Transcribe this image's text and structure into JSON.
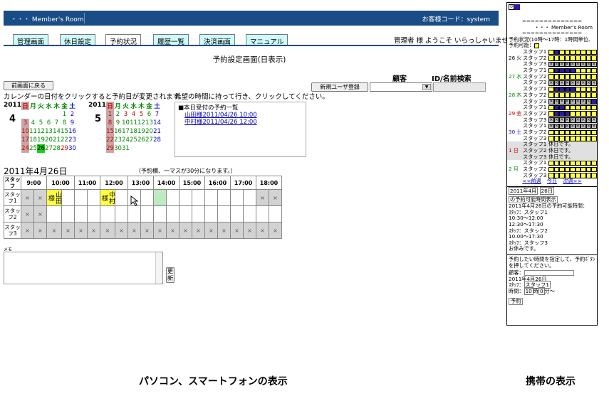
{
  "header": {
    "app_title": "・・・ Member's Room",
    "customer_code": "お客様コード：system"
  },
  "tabs": [
    "管理画面",
    "休日設定",
    "予約状況",
    "履歴一覧",
    "決済画面",
    "マニュアル"
  ],
  "greeting": "管理者 様 ようこそ いらっしゃいませ",
  "page_title": "予約設定画面(日表示)",
  "back_button": "前画面に戻る",
  "new_user_button": "新規ユーザ登録",
  "search_customer_label": "顧客",
  "search_id_label": "ID/名前検索",
  "calendar_hint": "カレンダーの日付をクリックすると予約日が変更されます。",
  "drag_hint": "希望の時間に持って行き、クリックしてください。",
  "cal_year": "2011",
  "weekdays": [
    "日",
    "月",
    "火",
    "水",
    "木",
    "金",
    "土"
  ],
  "cal_april": {
    "month": "4",
    "weeks": [
      [
        "",
        "",
        "",
        "",
        "",
        "1",
        "2"
      ],
      [
        "3",
        "4",
        "5",
        "6",
        "7",
        "8",
        "9"
      ],
      [
        "10",
        "11",
        "12",
        "13",
        "14",
        "15",
        "16"
      ],
      [
        "17",
        "18",
        "19",
        "20",
        "21",
        "22",
        "23"
      ],
      [
        "24",
        "25",
        "26",
        "27",
        "28",
        "29",
        "30"
      ]
    ]
  },
  "cal_may": {
    "month": "5",
    "weeks": [
      [
        "1",
        "2",
        "3",
        "4",
        "5",
        "6",
        "7"
      ],
      [
        "8",
        "9",
        "10",
        "11",
        "12",
        "13",
        "14"
      ],
      [
        "15",
        "16",
        "17",
        "18",
        "19",
        "20",
        "21"
      ],
      [
        "22",
        "23",
        "24",
        "25",
        "26",
        "27",
        "28"
      ],
      [
        "29",
        "30",
        "31",
        "",
        "",
        "",
        ""
      ]
    ]
  },
  "today_list": {
    "title": "■本日受付の予約一覧",
    "items": [
      "山田様2011/04/26 10:00",
      "中村様2011/04/26 12:00"
    ]
  },
  "schedule": {
    "date_title": "2011年4月26日",
    "note": "（予約欄、一マスが30分になります。）",
    "staff_col": "スタッフ",
    "hours": [
      "9:00",
      "10:00",
      "11:00",
      "12:00",
      "13:00",
      "14:00",
      "15:00",
      "16:00",
      "17:00",
      "18:00"
    ],
    "staff": [
      "スタッフ1",
      "スタッフ2",
      "スタッフ3"
    ],
    "res1": "山田様",
    "res2": "中村様"
  },
  "memo_label": "メモ",
  "update_button": "更新",
  "caption_pc": "パソコン、スマートフォンの表示",
  "caption_mobile": "携帯の表示",
  "mobile": {
    "title": "・・・ Member's Room",
    "status": "予約状況(10時〜17時：1時間単位、",
    "avail": "予約可能：",
    "days": [
      {
        "d": "26",
        "w": "火",
        "c": "#000"
      },
      {
        "d": "27",
        "w": "水",
        "c": "#080"
      },
      {
        "d": "28",
        "w": "木",
        "c": "#080"
      },
      {
        "d": "29",
        "w": "金",
        "c": "#c00"
      },
      {
        "d": "30",
        "w": "土",
        "c": "#00c"
      },
      {
        "d": "1",
        "w": "日",
        "c": "#c00"
      },
      {
        "d": "2",
        "w": "月",
        "c": "#080"
      }
    ],
    "staff": [
      "スタッフ1",
      "スタッフ2",
      "スタッフ3"
    ],
    "holiday": "休日です。",
    "nav": [
      "<<前週",
      "今日",
      "次週>>"
    ],
    "date_sel": "2011年4月",
    "day_sel": "26日",
    "show_btn": "の予約可能時間表示",
    "avail_title": "2011年4月26日の予約可能時間：",
    "avail_lines": [
      "ｽﾀｯﾌ：スタッフ1",
      "10:30〜12:00",
      "12:30〜17:30",
      "ｽﾀｯﾌ：スタッフ2",
      "10:00〜17:30",
      "ｽﾀｯﾌ：スタッフ3",
      "お休みです。"
    ],
    "instr": "予約したい時間を指定して、予約ﾎﾞﾀﾝを押してください。",
    "cust": "顧客：",
    "date2": "2011年4月26日",
    "staff_sel_label": "ｽﾀｯﾌ：",
    "staff_sel": "スタッフ1",
    "time_label": "時間：",
    "hour": "10",
    "hour_unit": "時",
    "min": "0",
    "min_unit": "分〜",
    "reserve_btn": "予約"
  }
}
